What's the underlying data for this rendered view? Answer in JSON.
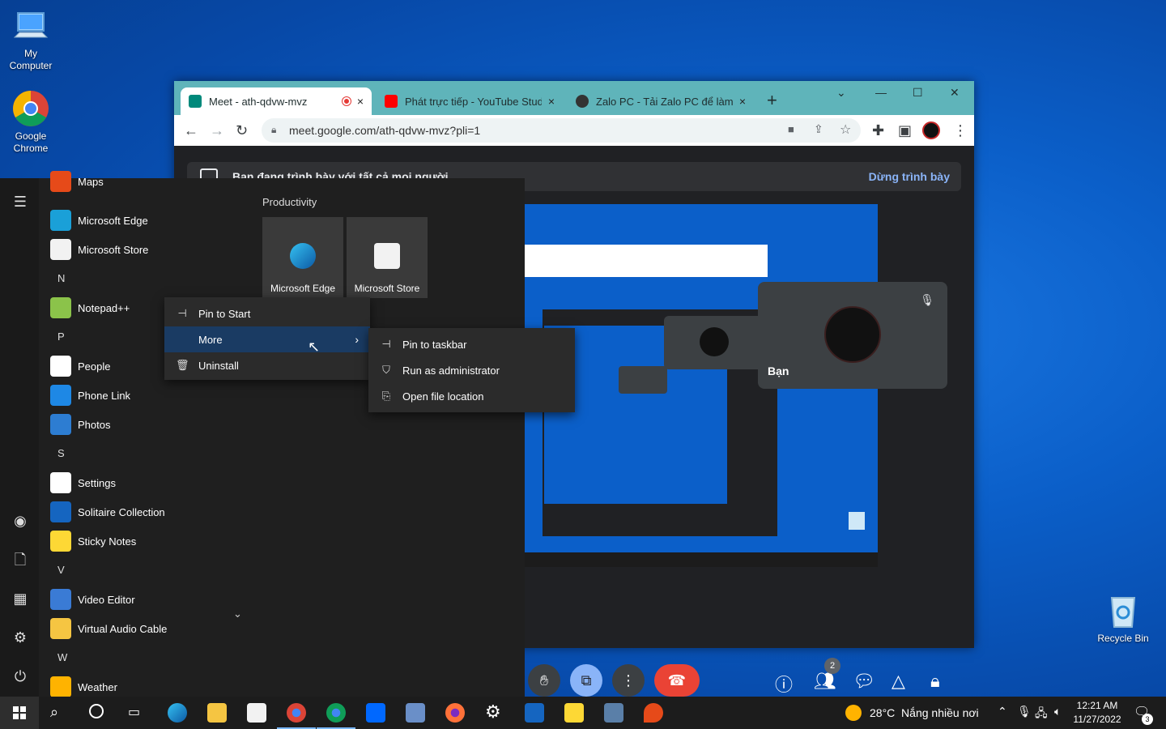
{
  "desktop": {
    "icons": {
      "my_computer": "My\nComputer",
      "chrome_label": "Google Chrome",
      "recycle_bin": "Recycle Bin"
    }
  },
  "chrome": {
    "tabs": [
      {
        "title": "Meet - ath-qdvw-mvz",
        "favicon_color": "#00897b"
      },
      {
        "title": "Phát trực tiếp - YouTube Studio",
        "favicon_color": "#ff0000"
      },
      {
        "title": "Zalo PC - Tải Zalo PC để làm việc",
        "favicon_color": "#333333"
      }
    ],
    "new_tab": "+",
    "close": "×",
    "url": "meet.google.com/ath-qdvw-mvz?pli=1",
    "window_controls": {
      "minimize": "—",
      "maximize": "☐",
      "close": "✕"
    }
  },
  "meet": {
    "banner_text": "Bạn đang trình bày với tất cả mọi người",
    "stop_presenting": "Dừng trình bày",
    "self_tile_name": "Bạn",
    "participants_count": "2",
    "accent": "#8ab4f8",
    "hangup_color": "#ea4335"
  },
  "start_menu": {
    "section_title": "Productivity",
    "tiles": [
      {
        "label": "Microsoft Edge"
      },
      {
        "label": "Microsoft Store"
      }
    ],
    "apps": [
      {
        "name": "Maps",
        "icon": "map-icon",
        "color": "#e64a19"
      },
      {
        "name": "Microsoft Edge",
        "icon": "edge-icon",
        "color": "#1aa0d8"
      },
      {
        "name": "Microsoft Store",
        "icon": "store-icon",
        "color": "#f2f2f2"
      },
      {
        "letter": "N"
      },
      {
        "name": "Notepad++",
        "icon": "notepadpp-icon",
        "color": "#8bc34a"
      },
      {
        "letter": "P"
      },
      {
        "name": "People",
        "icon": "people-icon",
        "color": "#ffffff"
      },
      {
        "name": "Phone Link",
        "icon": "phone-icon",
        "color": "#1e88e5"
      },
      {
        "name": "Photos",
        "icon": "photos-icon",
        "color": "#2d7dd2"
      },
      {
        "letter": "S"
      },
      {
        "name": "Settings",
        "icon": "gear-icon",
        "color": "#ffffff"
      },
      {
        "name": "Solitaire Collection",
        "icon": "cards-icon",
        "color": "#1565c0"
      },
      {
        "name": "Sticky Notes",
        "icon": "note-icon",
        "color": "#fdd835"
      },
      {
        "letter": "V"
      },
      {
        "name": "Video Editor",
        "icon": "video-icon",
        "color": "#3a7bd5"
      },
      {
        "name": "Virtual Audio Cable",
        "icon": "folder-icon",
        "color": "#f5c542"
      },
      {
        "letter": "W"
      },
      {
        "name": "Weather",
        "icon": "weather-icon",
        "color": "#ffb300"
      }
    ],
    "context_menu": {
      "pin_to_start": "Pin to Start",
      "more": "More",
      "uninstall": "Uninstall"
    },
    "submenu": {
      "pin_to_taskbar": "Pin to taskbar",
      "run_as_admin": "Run as administrator",
      "open_file_location": "Open file location"
    }
  },
  "taskbar": {
    "weather": "28°C  Nắng nhiều nơi",
    "time": "12:21 AM",
    "date": "11/27/2022",
    "notifications": "3"
  }
}
